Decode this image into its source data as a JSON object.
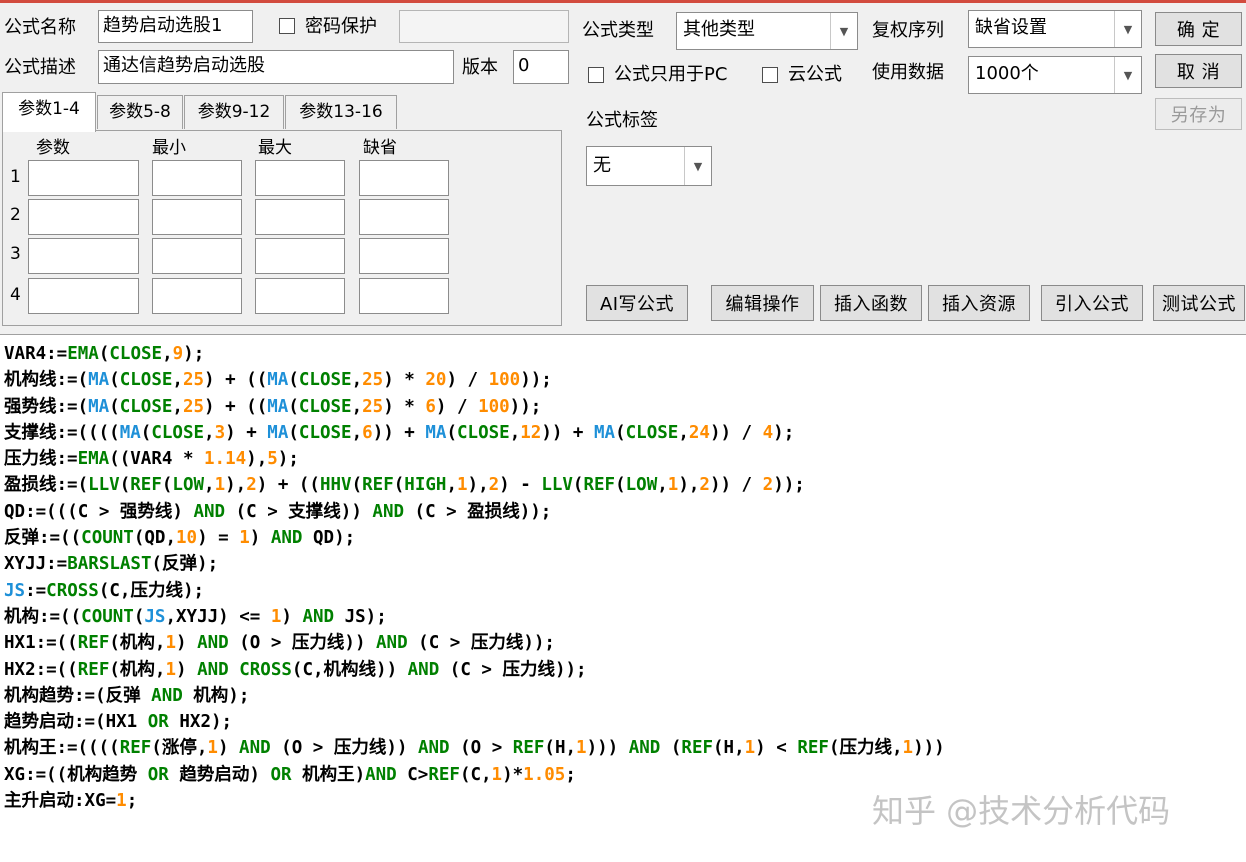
{
  "form": {
    "name_label": "公式名称",
    "name_value": "趋势启动选股1",
    "password_label": "密码保护",
    "desc_label": "公式描述",
    "desc_value": "通达信趋势启动选股",
    "version_label": "版本",
    "version_value": "0",
    "type_label": "公式类型",
    "type_value": "其他类型",
    "rights_label": "复权序列",
    "rights_value": "缺省设置",
    "pc_only_label": "公式只用于PC",
    "cloud_label": "云公式",
    "data_label": "使用数据",
    "data_value": "1000个",
    "tag_label": "公式标签",
    "tag_value": "无"
  },
  "buttons": {
    "ok": "确 定",
    "cancel": "取 消",
    "save_as": "另存为",
    "ai_write": "AI写公式",
    "edit_ops": "编辑操作",
    "insert_func": "插入函数",
    "insert_res": "插入资源",
    "import_formula": "引入公式",
    "test_formula": "测试公式"
  },
  "tabs": [
    "参数1-4",
    "参数5-8",
    "参数9-12",
    "参数13-16"
  ],
  "params": {
    "headers": [
      "参数",
      "最小",
      "最大",
      "缺省"
    ],
    "rows": [
      "1",
      "2",
      "3",
      "4"
    ]
  },
  "code_lines": [
    "VAR4:=EMA(CLOSE,9);",
    "机构线:=(MA(CLOSE,25) + ((MA(CLOSE,25) * 20) / 100));",
    "强势线:=(MA(CLOSE,25) + ((MA(CLOSE,25) * 6) / 100));",
    "支撑线:=((((MA(CLOSE,3) + MA(CLOSE,6)) + MA(CLOSE,12)) + MA(CLOSE,24)) / 4);",
    "压力线:=EMA((VAR4 * 1.14),5);",
    "盈损线:=(LLV(REF(LOW,1),2) + ((HHV(REF(HIGH,1),2) - LLV(REF(LOW,1),2)) / 2));",
    "QD:=(((C > 强势线) AND (C > 支撑线)) AND (C > 盈损线));",
    "反弹:=((COUNT(QD,10) = 1) AND QD);",
    "XYJJ:=BARSLAST(反弹);",
    "JS:=CROSS(C,压力线);",
    "机构:=((COUNT(JS,XYJJ) <= 1) AND JS);",
    "HX1:=((REF(机构,1) AND (O > 压力线)) AND (C > 压力线));",
    "HX2:=((REF(机构,1) AND CROSS(C,机构线)) AND (C > 压力线));",
    "机构趋势:=(反弹 AND 机构);",
    "趋势启动:=(HX1 OR HX2);",
    "机构王:=((((REF(涨停,1) AND (O > 压力线)) AND (O > REF(H,1))) AND (REF(H,1) < REF(压力线,1)))",
    "XG:=((机构趋势 OR 趋势启动) OR 机构王)AND C>REF(C,1)*1.05;",
    "主升启动:XG=1;"
  ],
  "watermark": "知乎 @技术分析代码",
  "colors": {
    "keyword": "#008000",
    "function": "#1e90d8",
    "number": "#ff8c00",
    "top_bar": "#d24b3e"
  }
}
